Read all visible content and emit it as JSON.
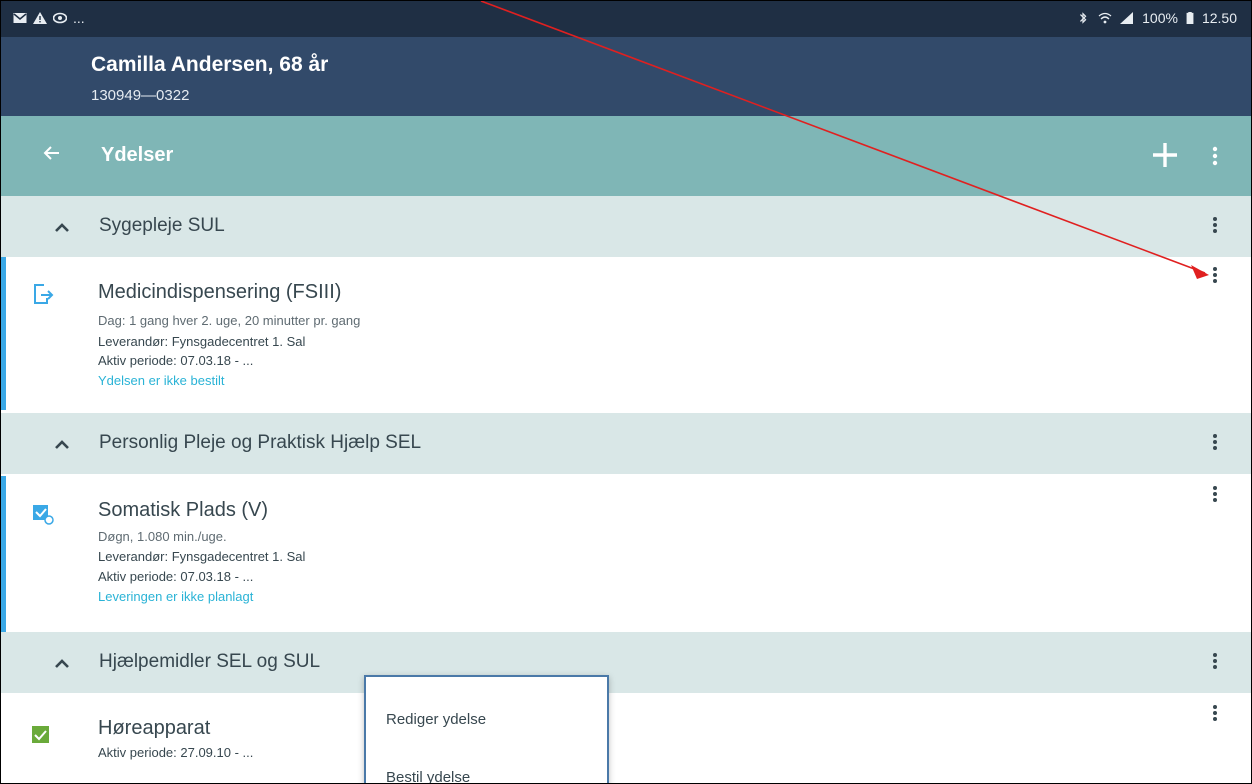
{
  "status_bar": {
    "left_icons": [
      "mail-icon",
      "warning-icon",
      "eye-icon"
    ],
    "ellipsis": "...",
    "right_text": "100%",
    "time": "12.50"
  },
  "patient": {
    "name": "Camilla Andersen, 68 år",
    "cpr": "130949—0322"
  },
  "toolbar": {
    "title": "Ydelser"
  },
  "sections": [
    {
      "label": "Sygepleje SUL",
      "items": [
        {
          "title": "Medicindispensering (FSIII)",
          "line1": "Dag: 1 gang hver 2. uge, 20 minutter pr. gang",
          "line2": "Leverandør:  Fynsgadecentret 1. Sal",
          "line3": "Aktiv periode:  07.03.18  -  ...",
          "status": "Ydelsen er ikke bestilt",
          "icon": "exit-icon"
        }
      ]
    },
    {
      "label": "Personlig Pleje og Praktisk Hjælp SEL",
      "items": [
        {
          "title": "Somatisk Plads (V)",
          "line1": "Døgn, 1.080 min./uge.",
          "line2": "Leverandør:  Fynsgadecentret 1. Sal",
          "line3": "Aktiv periode:  07.03.18  -  ...",
          "status": "Leveringen er ikke planlagt",
          "icon": "check-clock-icon"
        }
      ]
    },
    {
      "label": "Hjælpemidler SEL og SUL",
      "items": [
        {
          "title": "Høreapparat",
          "line1": "Aktiv periode:  27.09.10  -  ...",
          "icon": "checkbox-icon"
        }
      ]
    }
  ],
  "popup_menu": {
    "items": [
      "Rediger ydelse",
      "Bestil ydelse"
    ]
  },
  "colors": {
    "status_bar": "#1f2f44",
    "patient_header": "#324a6a",
    "toolbar": "#7fb6b6",
    "section": "#d9e7e7",
    "accent": "#3aa8e6",
    "link": "#2ab3d6",
    "arrow": "#e02020"
  }
}
